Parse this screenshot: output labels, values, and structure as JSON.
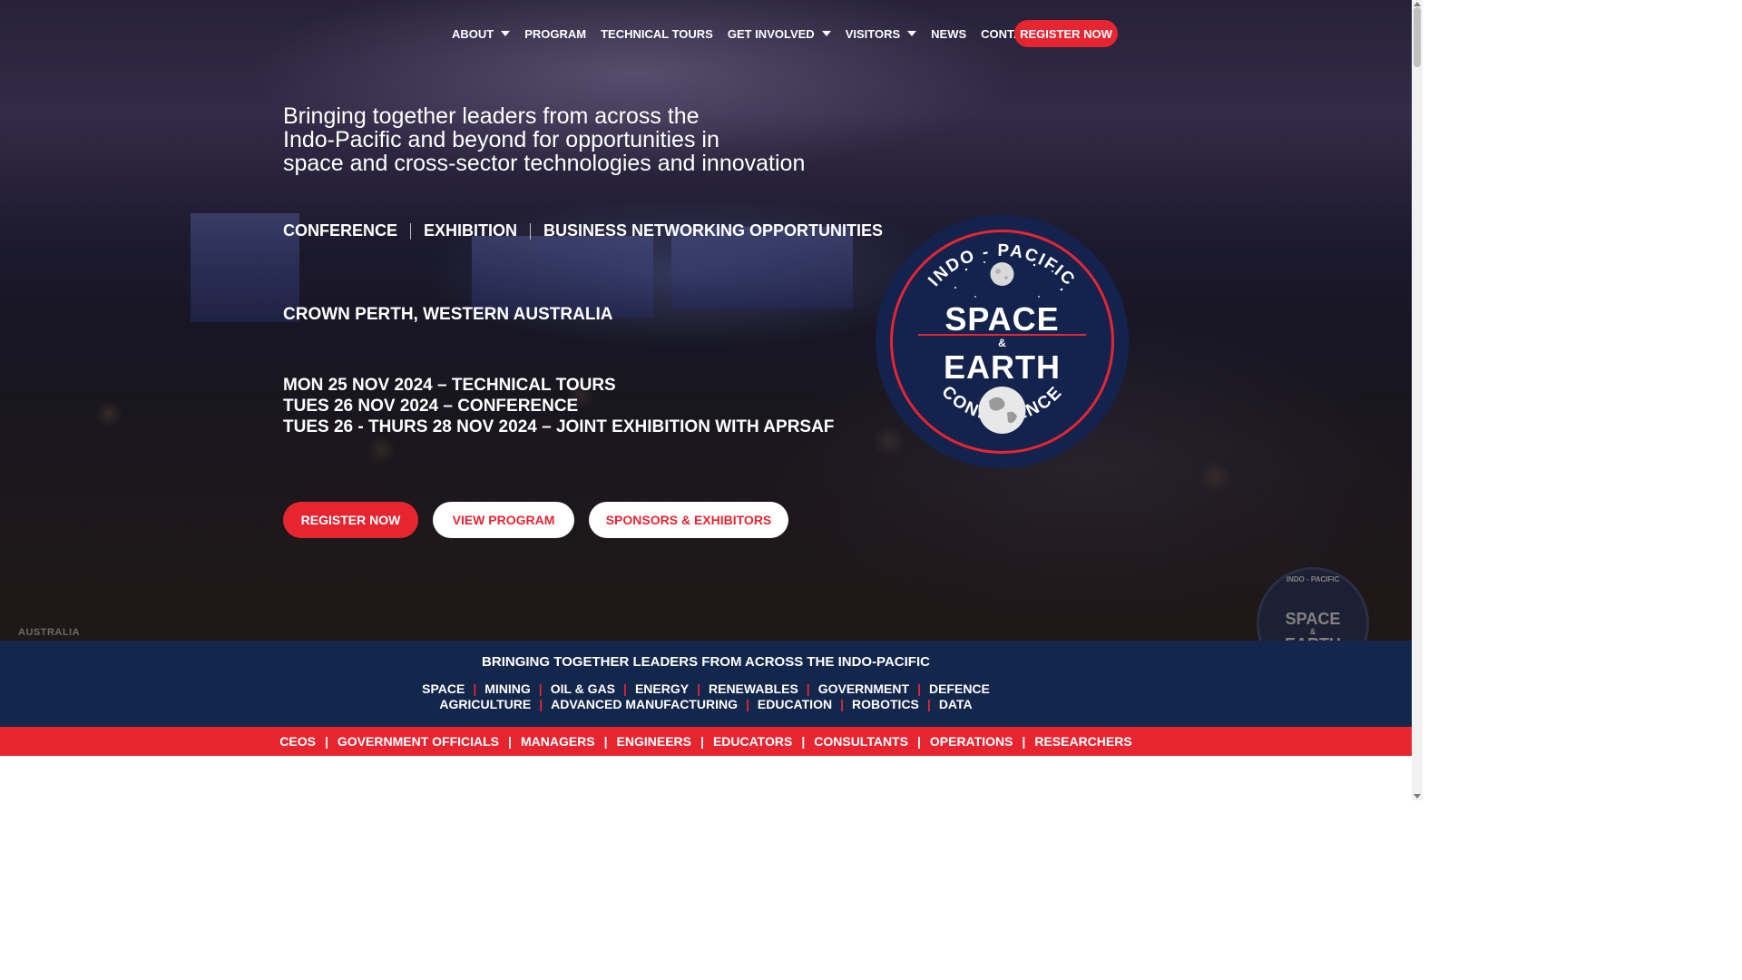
{
  "nav": {
    "items": [
      {
        "label": "ABOUT",
        "dropdown": true
      },
      {
        "label": "PROGRAM",
        "dropdown": false
      },
      {
        "label": "TECHNICAL TOURS",
        "dropdown": false
      },
      {
        "label": "GET INVOLVED",
        "dropdown": true
      },
      {
        "label": "VISITORS",
        "dropdown": true
      },
      {
        "label": "NEWS",
        "dropdown": false
      },
      {
        "label": "CONTACT",
        "dropdown": false
      }
    ],
    "register_label": "REGISTER NOW"
  },
  "hero": {
    "tagline_lines": [
      "Bringing together leaders from across the",
      "Indo-Pacific and beyond for opportunities in",
      "space and cross-sector technologies and innovation"
    ],
    "pillars": [
      "CONFERENCE",
      "EXHIBITION",
      "BUSINESS NETWORKING OPPORTUNITIES"
    ],
    "venue": "CROWN PERTH, WESTERN AUSTRALIA",
    "dates": [
      "MON 25 NOV 2024 – TECHNICAL TOURS",
      "TUES 26 NOV 2024 – CONFERENCE",
      "TUES 26 - THURS 28 NOV 2024 – JOINT EXHIBITION WITH APRSAF"
    ],
    "buttons": {
      "register": "REGISTER NOW",
      "program": "VIEW PROGRAM",
      "sponsors": "SPONSORS & EXHIBITORS"
    },
    "watermark": "AUSTRALIA",
    "logo": {
      "top_text": "INDO - PACIFIC",
      "line1": "SPACE",
      "amp": "&",
      "line2": "EARTH",
      "bottom_text": "CONFERENCE"
    },
    "ghost_logo": {
      "top_text": "INDO - PACIFIC",
      "line1": "SPACE",
      "amp": "&",
      "line2": "EARTH"
    }
  },
  "sectors": {
    "title": "BRINGING TOGETHER LEADERS FROM ACROSS THE INDO-PACIFIC",
    "row1": [
      "SPACE",
      "MINING",
      "OIL & GAS",
      "ENERGY",
      "RENEWABLES",
      "GOVERNMENT",
      "DEFENCE"
    ],
    "row2": [
      "AGRICULTURE",
      "ADVANCED MANUFACTURING",
      "EDUCATION",
      "ROBOTICS",
      "DATA"
    ]
  },
  "roles": [
    "CEOS",
    "GOVERNMENT OFFICIALS",
    "MANAGERS",
    "ENGINEERS",
    "EDUCATORS",
    "CONSULTANTS",
    "OPERATIONS",
    "RESEARCHERS"
  ],
  "colors": {
    "accent_red": "#e62531",
    "band_navy": "#13264b",
    "logo_navy": "#13234d"
  }
}
